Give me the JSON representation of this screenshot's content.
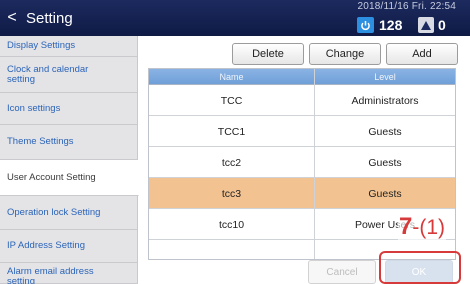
{
  "header": {
    "back_label": "<",
    "title": "Setting",
    "datetime": "2018/11/16 Fri. 22:54",
    "user_count": "128",
    "alert_count": "0"
  },
  "sidebar": {
    "items": [
      {
        "label": "Display Settings"
      },
      {
        "label": "Clock and calendar setting"
      },
      {
        "label": "Icon settings"
      },
      {
        "label": "Theme Settings"
      },
      {
        "label": "User Account Setting",
        "active": true
      },
      {
        "label": "Operation lock Setting"
      },
      {
        "label": "IP Address Setting"
      },
      {
        "label": "Alarm email address setting"
      }
    ]
  },
  "toolbar": {
    "delete_label": "Delete",
    "change_label": "Change",
    "add_label": "Add"
  },
  "table": {
    "headers": [
      "Name",
      "Level"
    ],
    "rows": [
      {
        "name": "TCC",
        "level": "Administrators"
      },
      {
        "name": "TCC1",
        "level": "Guests"
      },
      {
        "name": "tcc2",
        "level": "Guests"
      },
      {
        "name": "tcc3",
        "level": "Guests",
        "selected": true
      },
      {
        "name": "tcc10",
        "level": "Power Users"
      }
    ]
  },
  "footer": {
    "cancel_label": "Cancel",
    "ok_label": "OK"
  },
  "annotation": {
    "step_number": "7",
    "step_suffix": "-(1)"
  },
  "colors": {
    "header_bg": "#14204f",
    "selected_row": "#f2c391",
    "table_header": "#7aa7dd",
    "annotation": "#d73a3a"
  },
  "icons": {
    "user": "power-user-icon",
    "alert": "alert-a-icon"
  }
}
